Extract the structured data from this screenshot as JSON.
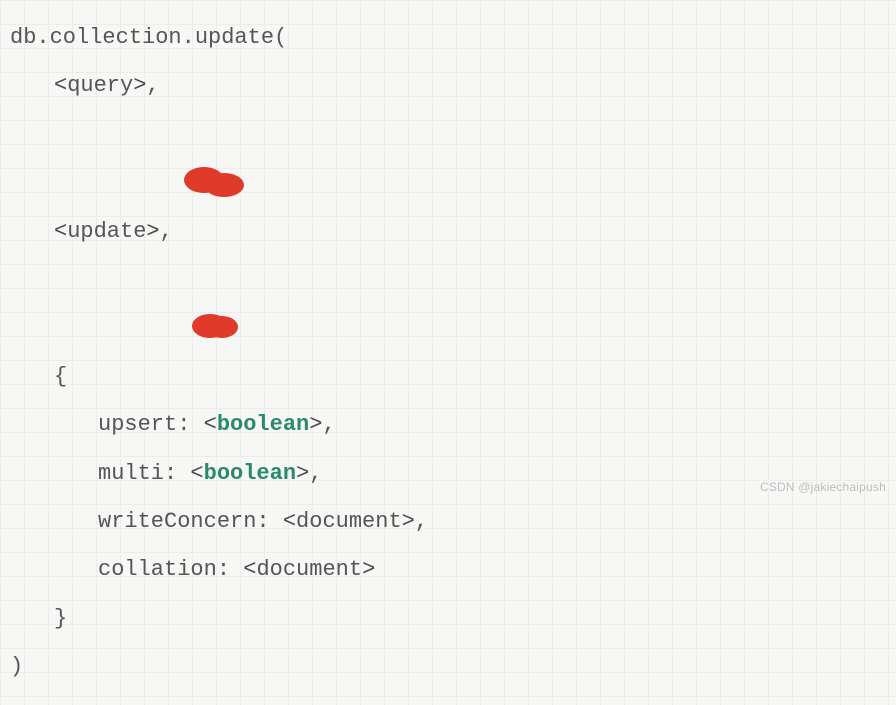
{
  "code": {
    "line1_pre": "db.collection.update(",
    "line2_param": "query",
    "line2_post": ",",
    "line3_param": "update",
    "line3_post": ",",
    "line4": "{",
    "line5_key": "upsert: ",
    "line5_type": "boolean",
    "line5_post": ",",
    "line6_key": "multi: ",
    "line6_type": "boolean",
    "line6_post": ",",
    "line7_key": "writeConcern: ",
    "line7_type": "document",
    "line7_post": ",",
    "line8_key": "collation: ",
    "line8_type": "document",
    "line9": "}",
    "line10": ")"
  },
  "watermark": "CSDN @jakiechaipush",
  "annotation_color": "#e03a2a"
}
